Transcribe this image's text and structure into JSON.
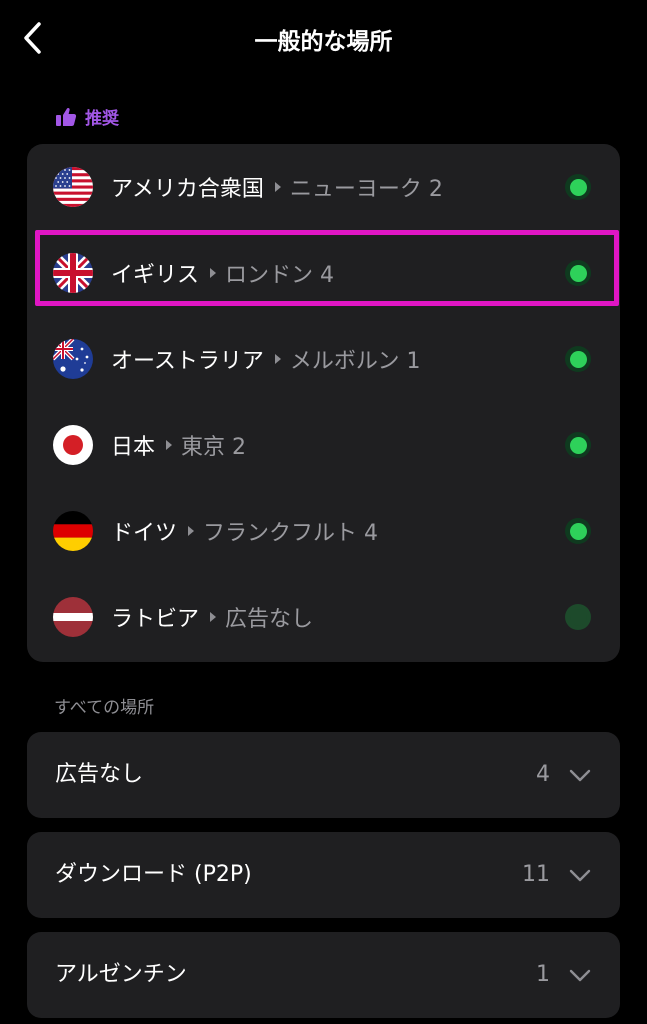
{
  "header": {
    "title": "一般的な場所",
    "back_icon": "chevron-left-icon"
  },
  "recommended": {
    "label": "推奨",
    "icon": "thumbs-up-icon",
    "accent_color": "#a257e6",
    "items": [
      {
        "country": "アメリカ合衆国",
        "city": "ニューヨーク 2",
        "flag": "us-flag-icon",
        "status": "online"
      },
      {
        "country": "イギリス",
        "city": "ロンドン 4",
        "flag": "uk-flag-icon",
        "status": "online"
      },
      {
        "country": "オーストラリア",
        "city": "メルボルン 1",
        "flag": "australia-flag-icon",
        "status": "online"
      },
      {
        "country": "日本",
        "city": "東京 2",
        "flag": "japan-flag-icon",
        "status": "online"
      },
      {
        "country": "ドイツ",
        "city": "フランクフルト 4",
        "flag": "germany-flag-icon",
        "status": "online"
      },
      {
        "country": "ラトビア",
        "city": "広告なし",
        "flag": "latvia-flag-icon",
        "status": "dim"
      }
    ]
  },
  "all_locations": {
    "label": "すべての場所",
    "groups": [
      {
        "name": "広告なし",
        "count": "4"
      },
      {
        "name": "ダウンロード (P2P)",
        "count": "11"
      },
      {
        "name": "アルゼンチン",
        "count": "1"
      }
    ]
  },
  "colors": {
    "highlight": "#e016c4",
    "status_green": "#2ed15a",
    "card_bg": "#1f1f21"
  }
}
